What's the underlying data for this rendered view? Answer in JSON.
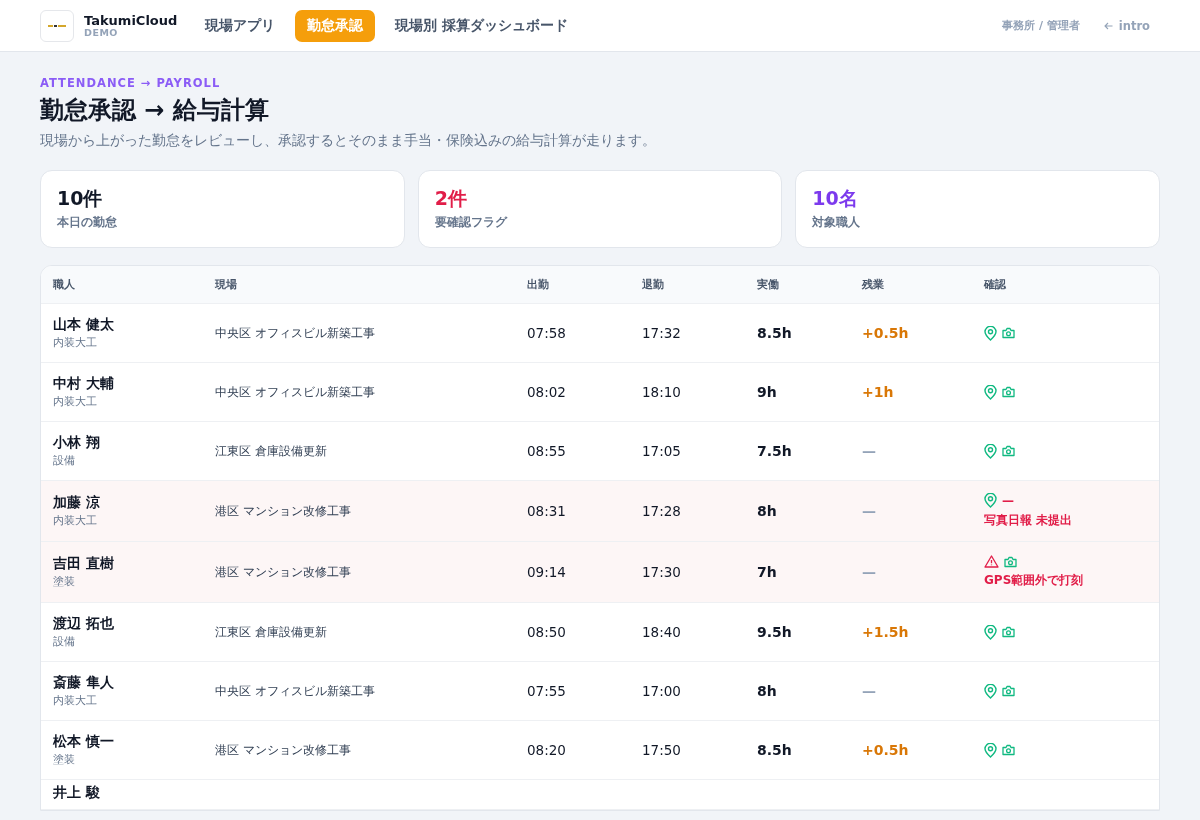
{
  "header": {
    "brand": "TakumiCloud",
    "brand_sub": "DEMO",
    "nav": [
      {
        "label": "現場アプリ",
        "selected": false
      },
      {
        "label": "勤怠承認",
        "selected": true
      },
      {
        "label": "現場別 採算ダッシュボード",
        "selected": false
      }
    ],
    "role": "事務所 / 管理者",
    "back_link": "intro"
  },
  "page": {
    "eyebrow": "ATTENDANCE → PAYROLL",
    "title": "勤怠承認 → 給与計算",
    "subtitle": "現場から上がった勤怠をレビューし、承認するとそのまま手当・保険込みの給与計算が走ります。"
  },
  "stats": [
    {
      "value": "10件",
      "label": "本日の勤怠",
      "color": "#111827"
    },
    {
      "value": "2件",
      "label": "要確認フラグ",
      "color": "#e11d48"
    },
    {
      "value": "10名",
      "label": "対象職人",
      "color": "#7c3aed"
    }
  ],
  "table": {
    "columns": [
      "職人",
      "現場",
      "出勤",
      "退勤",
      "実働",
      "残業",
      "確認"
    ],
    "rows": [
      {
        "name": "山本 健太",
        "role": "内装大工",
        "site": "中央区 オフィスビル新築工事",
        "in": "07:58",
        "out": "17:32",
        "worked": "8.5h",
        "overtime": "+0.5h",
        "has_overtime": true,
        "flagged": false,
        "gps_ok": true,
        "photo_ok": true
      },
      {
        "name": "中村 大輔",
        "role": "内装大工",
        "site": "中央区 オフィスビル新築工事",
        "in": "08:02",
        "out": "18:10",
        "worked": "9h",
        "overtime": "+1h",
        "has_overtime": true,
        "flagged": false,
        "gps_ok": true,
        "photo_ok": true
      },
      {
        "name": "小林 翔",
        "role": "設備",
        "site": "江東区 倉庫設備更新",
        "in": "08:55",
        "out": "17:05",
        "worked": "7.5h",
        "overtime": "—",
        "has_overtime": false,
        "flagged": false,
        "gps_ok": true,
        "photo_ok": true
      },
      {
        "name": "加藤 涼",
        "role": "内装大工",
        "site": "港区 マンション改修工事",
        "in": "08:31",
        "out": "17:28",
        "worked": "8h",
        "overtime": "—",
        "has_overtime": false,
        "flagged": true,
        "gps_ok": true,
        "photo_ok": false,
        "photo_mark": "—",
        "note": "写真日報 未提出"
      },
      {
        "name": "吉田 直樹",
        "role": "塗装",
        "site": "港区 マンション改修工事",
        "in": "09:14",
        "out": "17:30",
        "worked": "7h",
        "overtime": "—",
        "has_overtime": false,
        "flagged": true,
        "gps_ok": false,
        "photo_ok": true,
        "note": "GPS範囲外で打刻"
      },
      {
        "name": "渡辺 拓也",
        "role": "設備",
        "site": "江東区 倉庫設備更新",
        "in": "08:50",
        "out": "18:40",
        "worked": "9.5h",
        "overtime": "+1.5h",
        "has_overtime": true,
        "flagged": false,
        "gps_ok": true,
        "photo_ok": true
      },
      {
        "name": "斎藤 隼人",
        "role": "内装大工",
        "site": "中央区 オフィスビル新築工事",
        "in": "07:55",
        "out": "17:00",
        "worked": "8h",
        "overtime": "—",
        "has_overtime": false,
        "flagged": false,
        "gps_ok": true,
        "photo_ok": true
      },
      {
        "name": "松本 慎一",
        "role": "塗装",
        "site": "港区 マンション改修工事",
        "in": "08:20",
        "out": "17:50",
        "worked": "8.5h",
        "overtime": "+0.5h",
        "has_overtime": true,
        "flagged": false,
        "gps_ok": true,
        "photo_ok": true
      },
      {
        "name": "井上 駿"
      }
    ]
  }
}
